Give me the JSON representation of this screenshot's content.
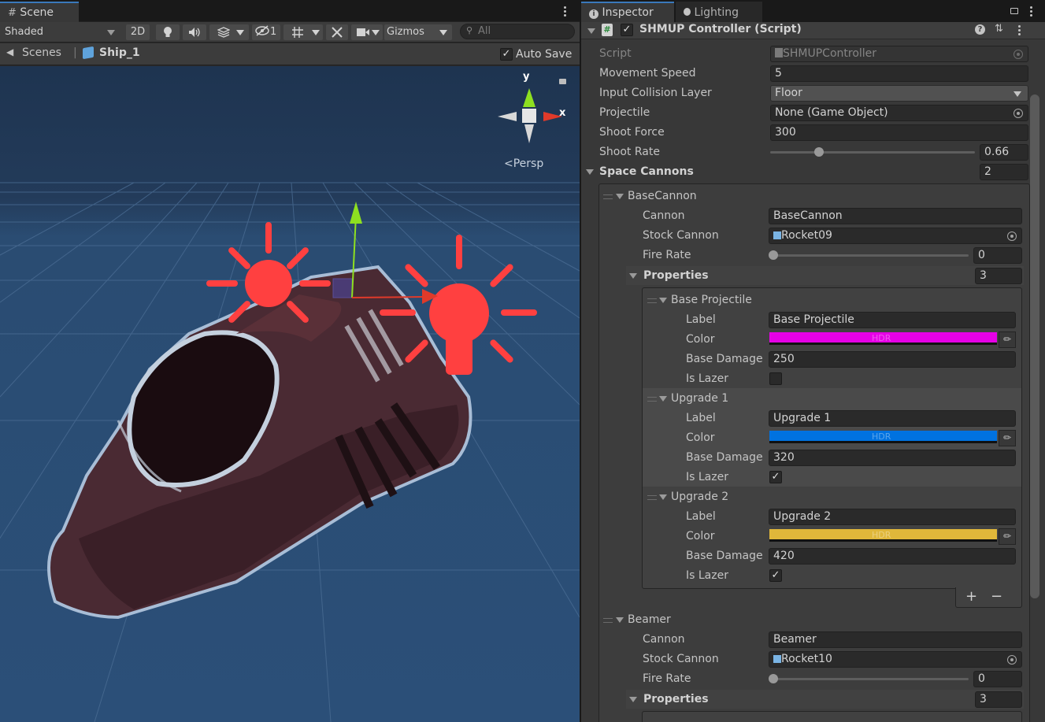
{
  "scene_panel": {
    "tab_label": "Scene",
    "shading_mode": "Shaded",
    "toolbar": {
      "twod_label": "2D",
      "hidden_count": "1",
      "gizmos_label": "Gizmos",
      "search_placeholder": "All"
    },
    "breadcrumb": {
      "root": "Scenes",
      "current": "Ship_1"
    },
    "auto_save_label": "Auto Save",
    "auto_save_checked": true,
    "orientation_gizmo": {
      "y_label": "y",
      "x_label": "x",
      "projection": "Persp"
    }
  },
  "inspector": {
    "tabs": [
      {
        "label": "Inspector",
        "active": true
      },
      {
        "label": "Lighting",
        "active": false
      }
    ],
    "component_title": "SHMUP Controller (Script)",
    "component_enabled": true,
    "fields": {
      "script": {
        "label": "Script",
        "value": "SHMUPController"
      },
      "movement_speed": {
        "label": "Movement Speed",
        "value": "5"
      },
      "input_collision_layer": {
        "label": "Input Collision Layer",
        "value": "Floor"
      },
      "projectile": {
        "label": "Projectile",
        "value": "None (Game Object)"
      },
      "shoot_force": {
        "label": "Shoot Force",
        "value": "300"
      },
      "shoot_rate": {
        "label": "Shoot Rate",
        "value": "0.66",
        "fraction": 0.24
      }
    },
    "space_cannons": {
      "label": "Space Cannons",
      "count": "2",
      "items": [
        {
          "name": "BaseCannon",
          "cannon_label": "Cannon",
          "cannon_value": "BaseCannon",
          "stock_label": "Stock Cannon",
          "stock_value": "Rocket09",
          "fire_rate_label": "Fire Rate",
          "fire_rate_value": "0",
          "properties_label": "Properties",
          "properties_count": "3",
          "properties": [
            {
              "name": "Base Projectile",
              "label_label": "Label",
              "label_value": "Base Projectile",
              "color_label": "Color",
              "color": "#e600e6",
              "hdr": "HDR",
              "damage_label": "Base Damage",
              "damage_value": "250",
              "lazer_label": "Is Lazer",
              "lazer": false
            },
            {
              "name": "Upgrade 1",
              "label_label": "Label",
              "label_value": "Upgrade 1",
              "color_label": "Color",
              "color": "#0072e0",
              "hdr": "HDR",
              "damage_label": "Base Damage",
              "damage_value": "320",
              "lazer_label": "Is Lazer",
              "lazer": true
            },
            {
              "name": "Upgrade 2",
              "label_label": "Label",
              "label_value": "Upgrade 2",
              "color_label": "Color",
              "color": "#e0b73a",
              "hdr": "HDR",
              "damage_label": "Base Damage",
              "damage_value": "420",
              "lazer_label": "Is Lazer",
              "lazer": true
            }
          ],
          "add_label": "+",
          "remove_label": "−"
        },
        {
          "name": "Beamer",
          "cannon_label": "Cannon",
          "cannon_value": "Beamer",
          "stock_label": "Stock Cannon",
          "stock_value": "Rocket10",
          "fire_rate_label": "Fire Rate",
          "fire_rate_value": "0",
          "properties_label": "Properties",
          "properties_count": "3"
        }
      ]
    }
  }
}
